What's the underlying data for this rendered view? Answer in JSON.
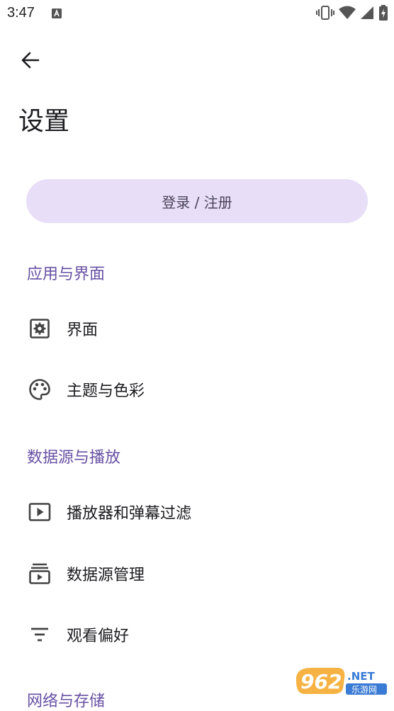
{
  "status_bar": {
    "time": "3:47",
    "icons": [
      "notification-a-icon",
      "vibrate-icon",
      "wifi-icon",
      "signal-icon",
      "battery-charging-icon"
    ]
  },
  "header": {
    "back_icon": "arrow-back-icon",
    "title": "设置"
  },
  "login_button": {
    "label": "登录 / 注册",
    "background": "#e8def8"
  },
  "sections": [
    {
      "title": "应用与界面",
      "items": [
        {
          "label": "界面",
          "icon": "settings-box-icon"
        },
        {
          "label": "主题与色彩",
          "icon": "palette-icon"
        }
      ]
    },
    {
      "title": "数据源与播放",
      "items": [
        {
          "label": "播放器和弹幕过滤",
          "icon": "play-box-icon"
        },
        {
          "label": "数据源管理",
          "icon": "subscriptions-icon"
        },
        {
          "label": "观看偏好",
          "icon": "filter-list-icon"
        }
      ]
    },
    {
      "title": "网络与存储",
      "items": []
    }
  ],
  "watermark": {
    "logo_text": "962",
    "suffix": ".NET",
    "caption": "乐游网"
  },
  "colors": {
    "accent": "#6750a4",
    "text": "#1c1b1f",
    "button_bg": "#e8def8"
  }
}
